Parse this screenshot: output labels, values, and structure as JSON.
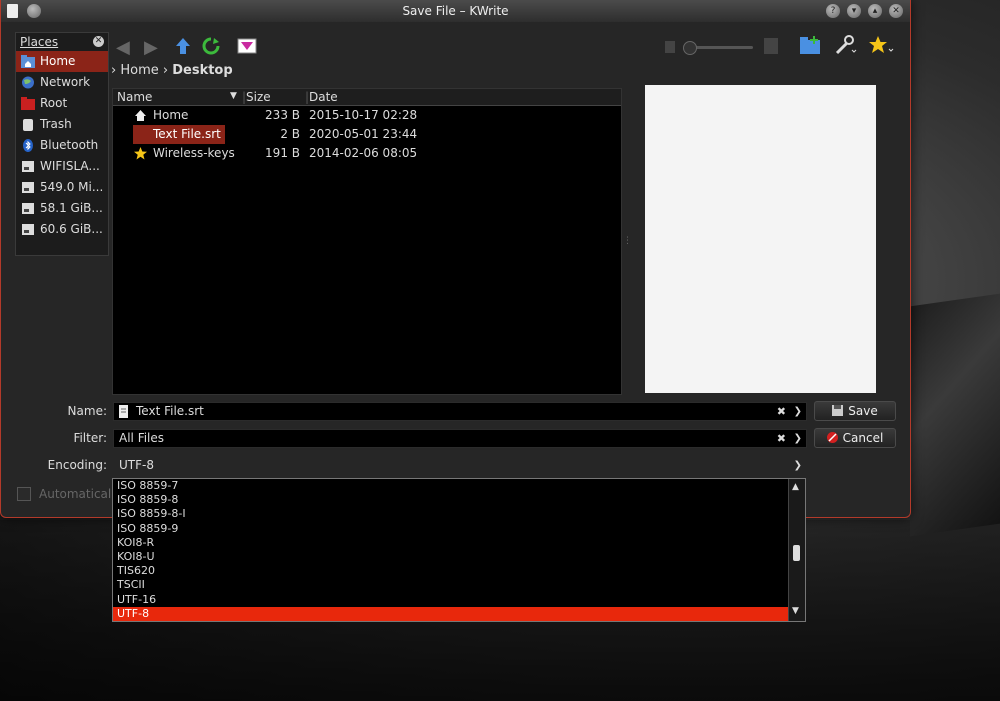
{
  "window": {
    "title": "Save File – KWrite"
  },
  "places": {
    "header": "Places",
    "items": [
      {
        "label": "Home",
        "icon": "home-folder-icon"
      },
      {
        "label": "Network",
        "icon": "globe-icon"
      },
      {
        "label": "Root",
        "icon": "red-folder-icon"
      },
      {
        "label": "Trash",
        "icon": "trash-icon"
      },
      {
        "label": "Bluetooth",
        "icon": "bluetooth-icon"
      },
      {
        "label": "WIFISLA...",
        "icon": "drive-icon"
      },
      {
        "label": "549.0 Mi...",
        "icon": "drive-icon"
      },
      {
        "label": "58.1 GiB...",
        "icon": "drive-icon"
      },
      {
        "label": "60.6 GiB...",
        "icon": "drive-icon"
      }
    ]
  },
  "breadcrumb": {
    "parent": "Home",
    "current": "Desktop"
  },
  "filelist": {
    "columns": {
      "name": "Name",
      "size": "Size",
      "date": "Date"
    },
    "rows": [
      {
        "name": "Home",
        "size": "233 B",
        "date": "2015-10-17 02:28"
      },
      {
        "name": "Text File.srt",
        "size": "2 B",
        "date": "2020-05-01 23:44"
      },
      {
        "name": "Wireless-keys",
        "size": "191 B",
        "date": "2014-02-06 08:05"
      }
    ]
  },
  "form": {
    "name_label": "Name:",
    "name_value": "Text File.srt",
    "filter_label": "Filter:",
    "filter_value": "All Files",
    "encoding_label": "Encoding:",
    "encoding_value": "UTF-8",
    "auto_label": "Automatical",
    "save_label": "Save",
    "cancel_label": "Cancel"
  },
  "encoding_options": [
    "ISO 8859-7",
    "ISO 8859-8",
    "ISO 8859-8-I",
    "ISO 8859-9",
    "KOI8-R",
    "KOI8-U",
    "TIS620",
    "TSCII",
    "UTF-16",
    "UTF-8"
  ],
  "colors": {
    "accent": "#e8280c",
    "selection": "#8b2418",
    "window_border": "#b33a2a"
  }
}
